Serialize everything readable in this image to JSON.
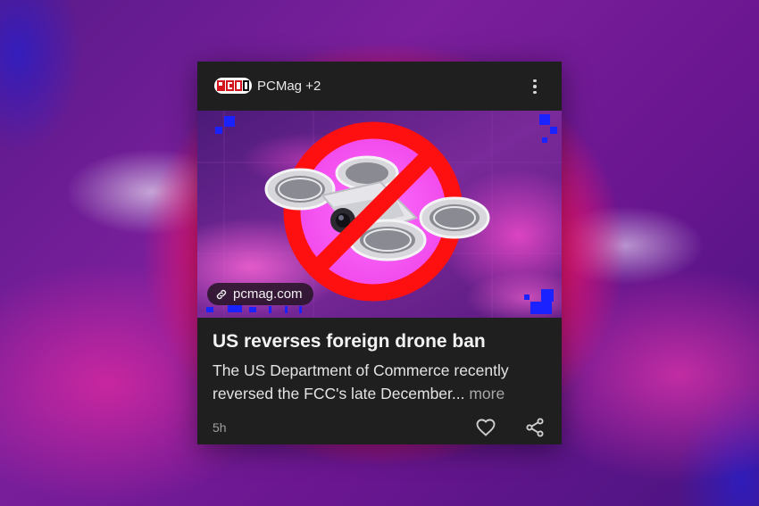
{
  "card": {
    "source": {
      "label": "PCMag +2",
      "logo_icon": "pcmag-logo-icon"
    },
    "menu_icon": "more-vert-icon",
    "image": {
      "description_icon": "no-drone-ban-icon",
      "chip": {
        "icon": "link-icon",
        "label": "pcmag.com"
      }
    },
    "headline": "US reverses foreign drone ban",
    "summary": "The US Department of Commerce recently reversed the FCC's late December...",
    "more_label": "more",
    "timestamp": "5h",
    "actions": {
      "like_icon": "heart-icon",
      "share_icon": "share-icon"
    }
  },
  "colors": {
    "card_background": "#1f1f1f",
    "ban_sign_red": "#ff1010",
    "backdrop_glow": "#ff2a3a"
  }
}
